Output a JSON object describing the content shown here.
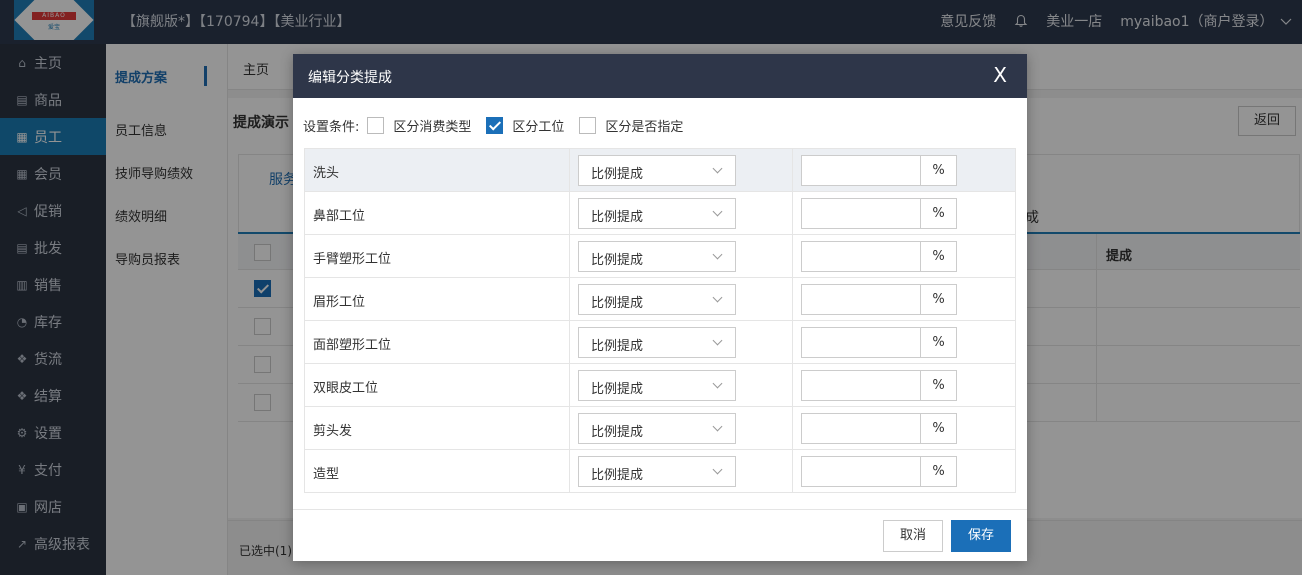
{
  "header": {
    "logo_text": "AIBAO",
    "logo_sub": "爱宝",
    "title": "【旗舰版*】【170794】【美业行业】",
    "feedback": "意见反馈",
    "store": "美业一店",
    "user": "myaibao1（商户登录）"
  },
  "sidebar": {
    "items": [
      {
        "label": "主页",
        "icon": "⌂"
      },
      {
        "label": "商品",
        "icon": "▤"
      },
      {
        "label": "员工",
        "icon": "▦"
      },
      {
        "label": "会员",
        "icon": "▦"
      },
      {
        "label": "促销",
        "icon": "◁"
      },
      {
        "label": "批发",
        "icon": "▤"
      },
      {
        "label": "销售",
        "icon": "▥"
      },
      {
        "label": "库存",
        "icon": "◔"
      },
      {
        "label": "货流",
        "icon": "❖"
      },
      {
        "label": "结算",
        "icon": "❖"
      },
      {
        "label": "设置",
        "icon": "⚙"
      },
      {
        "label": "支付",
        "icon": "¥"
      },
      {
        "label": "网店",
        "icon": "▣"
      },
      {
        "label": "高级报表",
        "icon": "↗"
      }
    ]
  },
  "subnav": {
    "items": [
      "提成方案",
      "员工信息",
      "技师导购绩效",
      "绩效明细",
      "导购员报表"
    ]
  },
  "main": {
    "tab_home": "主页",
    "panel_title": "提成演示",
    "back": "返回",
    "tab_service": "服务",
    "tab_right": "成",
    "col_ticheng": "提成",
    "selected": "已选中(1)"
  },
  "modal": {
    "title": "编辑分类提成",
    "close": "X",
    "cond_label": "设置条件:",
    "options": [
      {
        "label": "区分消费类型",
        "checked": false
      },
      {
        "label": "区分工位",
        "checked": true
      },
      {
        "label": "区分是否指定",
        "checked": false
      }
    ],
    "rows": [
      {
        "name": "洗头",
        "mode": "比例提成",
        "unit": "%"
      },
      {
        "name": "鼻部工位",
        "mode": "比例提成",
        "unit": "%"
      },
      {
        "name": "手臂塑形工位",
        "mode": "比例提成",
        "unit": "%"
      },
      {
        "name": "眉形工位",
        "mode": "比例提成",
        "unit": "%"
      },
      {
        "name": "面部塑形工位",
        "mode": "比例提成",
        "unit": "%"
      },
      {
        "name": "双眼皮工位",
        "mode": "比例提成",
        "unit": "%"
      },
      {
        "name": "剪头发",
        "mode": "比例提成",
        "unit": "%"
      },
      {
        "name": "造型",
        "mode": "比例提成",
        "unit": "%"
      }
    ],
    "cancel": "取消",
    "save": "保存"
  }
}
